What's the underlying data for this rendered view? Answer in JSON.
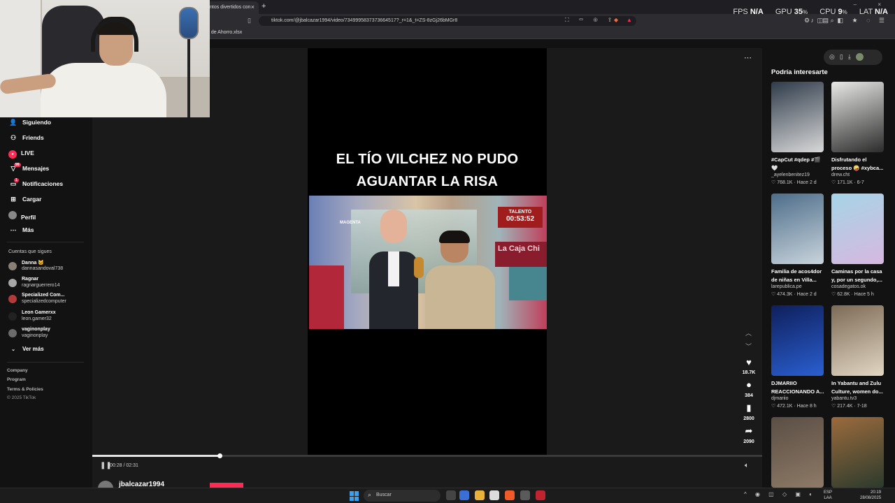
{
  "browser": {
    "tab_title": "ntos divertidos con",
    "tab_close": "×",
    "new_tab": "+",
    "url": "tiktok.com/@jbalcazar1994/video/7349995837373664517?_r=1&_t=ZS-8zGj26bMGr8",
    "bookmark_label": "n de Ahorro.xlsx",
    "window_controls": "–  ×"
  },
  "hud": {
    "fps_label": "FPS",
    "fps_value": "N/A",
    "gpu_label": "GPU",
    "gpu_value": "35",
    "cpu_label": "CPU",
    "cpu_value": "9",
    "lat_label": "LAT",
    "lat_value": "N/A"
  },
  "sidebar": {
    "items": [
      {
        "label": "Siguiendo",
        "icon": "following-icon"
      },
      {
        "label": "Friends",
        "icon": "friends-icon"
      },
      {
        "label": "LIVE",
        "icon": "live-icon"
      },
      {
        "label": "Mensajes",
        "icon": "messages-icon",
        "badge": "99"
      },
      {
        "label": "Notificaciones",
        "icon": "notifications-icon",
        "badge": "1"
      },
      {
        "label": "Cargar",
        "icon": "upload-icon"
      },
      {
        "label": "Perfil",
        "icon": "profile-icon"
      },
      {
        "label": "Más",
        "icon": "more-icon"
      }
    ],
    "following_title": "Cuentas que sigues",
    "accounts": [
      {
        "name": "Danna 🐱",
        "handle": "dannasandoval738"
      },
      {
        "name": "Ragnar",
        "handle": "ragnarguerrero14"
      },
      {
        "name": "Specialized Com...",
        "handle": "specializedcomputer"
      },
      {
        "name": "Leon Gamerxx",
        "handle": "leon.gamer32"
      },
      {
        "name": "vaginonplay",
        "handle": "vaginonplay"
      }
    ],
    "see_more": "Ver más",
    "footer": [
      "Company",
      "Program",
      "Terms & Policies",
      "© 2025 TikTok"
    ]
  },
  "video": {
    "caption_line1": "EL TÍO VILCHEZ NO PUDO",
    "caption_line2": "AGUANTAR LA RISA",
    "clip_sign": "La Caja Chi",
    "clip_timer_top": "TALENTO",
    "clip_timer": "00:53:52",
    "clip_logo": "MAGENTA",
    "time": "00:28 / 02:31",
    "progress": 0.19,
    "author": "jbalcazar1994",
    "likes": "18.7K",
    "comments": "384",
    "saves": "2800",
    "shares": "2090"
  },
  "recommendations": {
    "title": "Podría interesarte",
    "items": [
      {
        "title1": "#CapCut #qdep #🎬",
        "title2": "🤍",
        "author": "_ayelenbenitez19",
        "views": "768.1K",
        "time": "Hace 2 d",
        "colors": [
          "#2f3b4a",
          "#d8d8d8"
        ]
      },
      {
        "title1": "Disfrutando el",
        "title2": "proceso 🤪 #xybca...",
        "author": "drew.cht",
        "views": "171.1K",
        "time": "6-7",
        "colors": [
          "#e8e8e6",
          "#2b2b2b"
        ]
      },
      {
        "title1": "Familia de acos4dor",
        "title2": "de niñas en Villa...",
        "author": "larepublica.pe",
        "views": "474.3K",
        "time": "Hace 2 d",
        "colors": [
          "#4d6d8a",
          "#c9d4dc"
        ]
      },
      {
        "title1": "Caminas por la casa",
        "title2": "y, por un segundo,...",
        "author": "cosadegatos.ok",
        "views": "62.8K",
        "time": "Hace 5 h",
        "colors": [
          "#a6d4e6",
          "#d7b8e0"
        ]
      },
      {
        "title1": "DJMARIIO",
        "title2": "REACCIONANDO A...",
        "author": "djmariio",
        "views": "472.1K",
        "time": "Hace 8 h",
        "colors": [
          "#0f1f5c",
          "#2a5fd0"
        ]
      },
      {
        "title1": "In Yabantu and Zulu",
        "title2": "Culture, women do...",
        "author": "yabantu.tv3",
        "views": "217.4K",
        "time": "7-18",
        "colors": [
          "#7c6a56",
          "#e2d7c4"
        ]
      },
      {
        "title1": "",
        "title2": "",
        "author": "",
        "views": "",
        "time": "",
        "colors": [
          "#5a4e44",
          "#8e7a67"
        ]
      },
      {
        "title1": "",
        "title2": "",
        "author": "",
        "views": "",
        "time": "",
        "colors": [
          "#9b6b3d",
          "#2c3a2c"
        ]
      }
    ]
  },
  "taskbar": {
    "search_placeholder": "Buscar",
    "lang_line1": "ESP",
    "lang_line2": "LAA",
    "time": "20:19",
    "date": "28/08/2025"
  },
  "colors": {
    "accent": "#fe2c55",
    "background": "#121212"
  }
}
